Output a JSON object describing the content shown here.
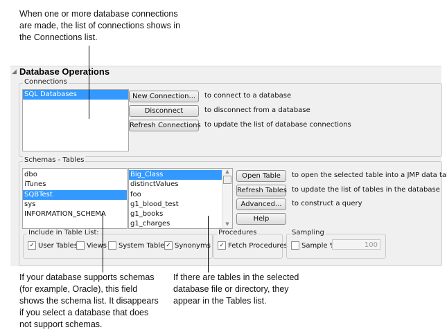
{
  "callouts": {
    "top": [
      "When one or more database connections",
      "are made, the list of connections shows in",
      "the Connections list."
    ],
    "schemas": [
      "If your database supports schemas",
      "(for example, Oracle), this field",
      "shows the schema list. It disappears",
      "if you select a database that does",
      "not support schemas."
    ],
    "tables": [
      "If there are tables in the selected",
      "database file or directory, they",
      "appear in the Tables list."
    ]
  },
  "panel": {
    "title": "Database Operations",
    "collapse_icon": "triangle-icon"
  },
  "connections": {
    "label": "Connections",
    "items": [
      {
        "label": "SQL Databases",
        "selected": true
      }
    ],
    "buttons": [
      {
        "label": "New Connection...",
        "desc": "to connect to a database"
      },
      {
        "label": "Disconnect",
        "desc": "to disconnect from a database"
      },
      {
        "label": "Refresh Connections",
        "desc": "to update the list of database connections"
      }
    ]
  },
  "schemas_tables": {
    "label": "Schemas - Tables",
    "schemas": [
      {
        "label": "dbo"
      },
      {
        "label": "iTunes"
      },
      {
        "label": "SQBTest",
        "selected": true
      },
      {
        "label": "sys"
      },
      {
        "label": "INFORMATION_SCHEMA"
      }
    ],
    "tables": [
      {
        "label": "Big_Class",
        "selected": true
      },
      {
        "label": "distinctValues"
      },
      {
        "label": "foo"
      },
      {
        "label": "g1_blood_test"
      },
      {
        "label": "g1_books"
      },
      {
        "label": "g1_charges"
      }
    ],
    "buttons": [
      {
        "label": "Open Table",
        "desc": "to open the selected table into a JMP data table"
      },
      {
        "label": "Refresh Tables",
        "desc": "to update the list of tables in the database"
      },
      {
        "label": "Advanced...",
        "desc": "to construct a query"
      },
      {
        "label": "Help",
        "desc": ""
      }
    ],
    "include": {
      "label": "Include in Table List:",
      "options": [
        {
          "label": "User Tables",
          "checked": true
        },
        {
          "label": "Views",
          "checked": false
        },
        {
          "label": "System Tables",
          "checked": false
        },
        {
          "label": "Synonyms",
          "checked": true
        }
      ]
    },
    "procedures": {
      "label": "Procedures",
      "option": {
        "label": "Fetch Procedures",
        "checked": true
      }
    },
    "sampling": {
      "label": "Sampling",
      "option": {
        "label": "Sample %",
        "checked": false
      },
      "value": "100"
    }
  }
}
